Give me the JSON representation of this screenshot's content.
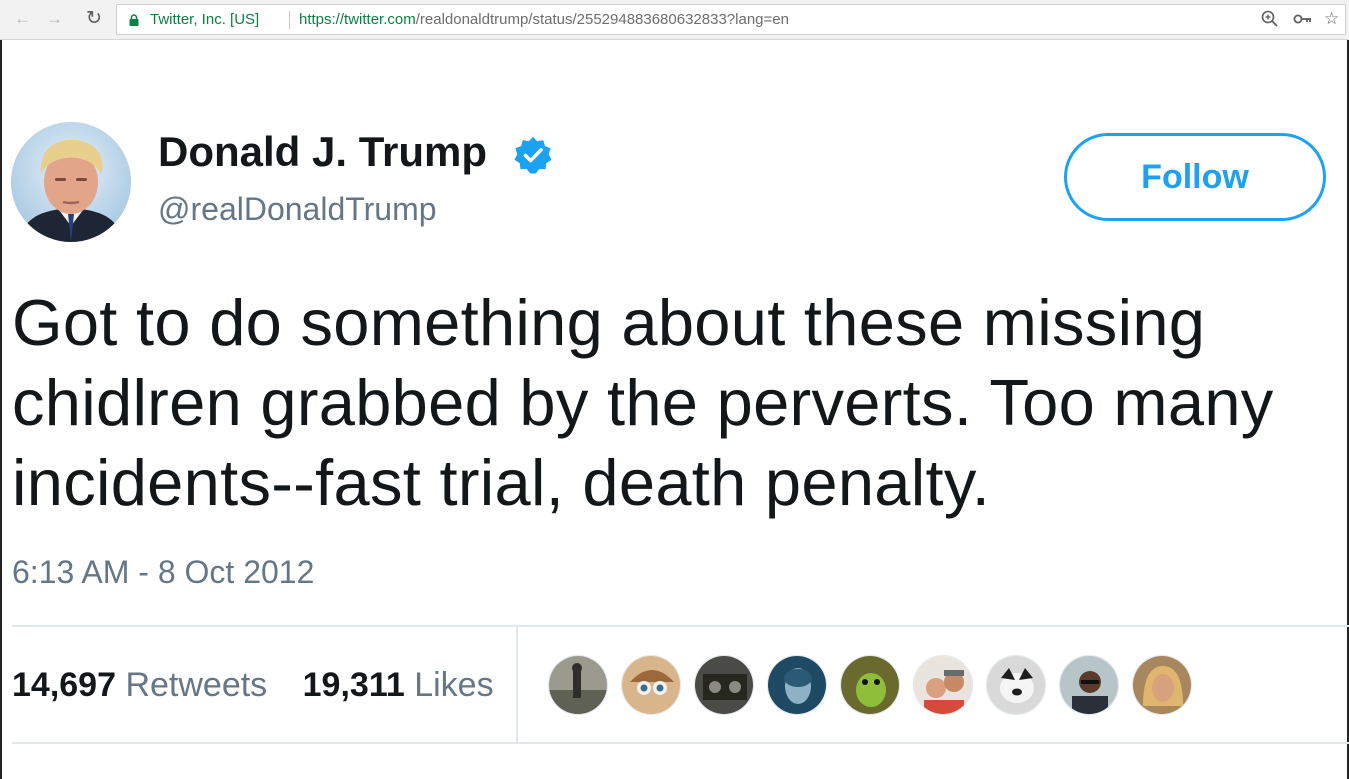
{
  "browser": {
    "back_icon": "back-arrow-icon",
    "forward_icon": "forward-arrow-icon",
    "reload_icon": "reload-icon",
    "site_identity": "Twitter, Inc. [US]",
    "url_host": "https://twitter.com",
    "url_path": "/realdonaldtrump/status/255294883680632833?lang=en",
    "zoom_icon": "zoom-icon",
    "key_icon": "key-icon",
    "star_icon": "bookmark-star-icon",
    "secure_color": "#0b8043"
  },
  "tweet": {
    "author": {
      "display_name": "Donald J. Trump",
      "handle": "@realDonaldTrump",
      "verified": true,
      "verified_color": "#1da1f2"
    },
    "follow_label": "Follow",
    "text_lines": [
      "Got to do something about these missing",
      "chidlren grabbed by the perverts. Too many",
      "incidents--fast trial, death penalty."
    ],
    "timestamp": "6:13 AM - 8 Oct 2012",
    "stats": {
      "retweets_count": "14,697",
      "retweets_label": "Retweets",
      "likes_count": "19,311",
      "likes_label": "Likes"
    },
    "liker_avatar_count": 9,
    "accent_color": "#1da1f2"
  }
}
